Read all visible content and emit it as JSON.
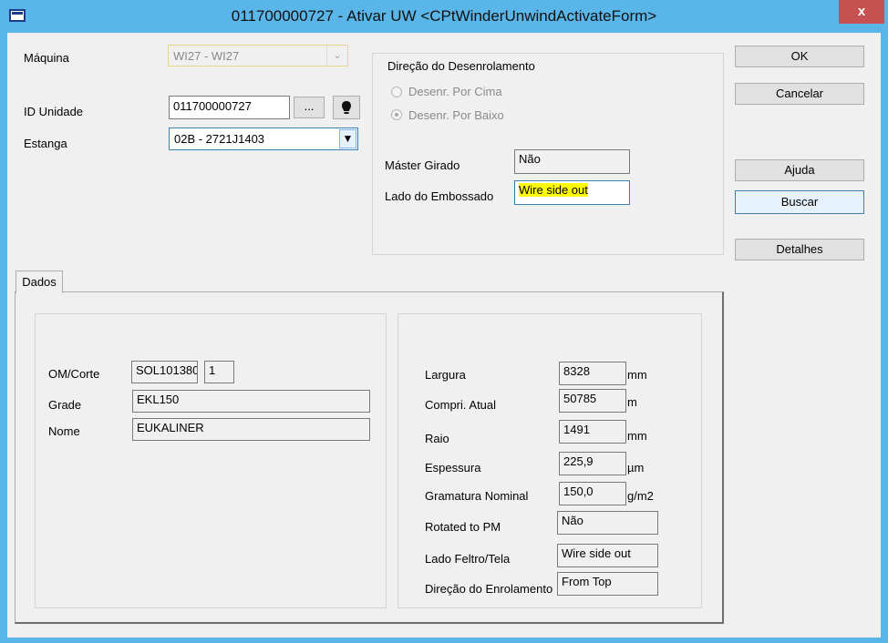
{
  "window": {
    "title": "011700000727 - Ativar UW <CPtWinderUnwindActivateForm>",
    "close_label": "x"
  },
  "header": {
    "maquina": {
      "label": "Máquina",
      "value": "WI27 - WI27"
    },
    "id_unidade": {
      "label": "ID Unidade",
      "value": "011700000727",
      "browse_label": "..."
    },
    "estanga": {
      "label": "Estanga",
      "value": "02B - 2721J1403"
    }
  },
  "direction_group": {
    "title": "Direção do Desenrolamento",
    "options": [
      {
        "label": "Desenr. Por Cima",
        "selected": false
      },
      {
        "label": "Desenr. Por Baixo",
        "selected": true
      }
    ],
    "master_girado": {
      "label": "Máster Girado",
      "value": "Não"
    },
    "lado_embossado": {
      "label": "Lado do Embossado",
      "value": "Wire side out",
      "highlight": "#ffff00"
    }
  },
  "buttons": {
    "ok": "OK",
    "cancelar": "Cancelar",
    "ajuda": "Ajuda",
    "buscar": "Buscar",
    "detalhes": "Detalhes"
  },
  "tabs": [
    {
      "label": "Dados",
      "active": true
    }
  ],
  "dados_left": {
    "om_corte": {
      "label": "OM/Corte",
      "value": "SOL101380",
      "value2": "1"
    },
    "grade": {
      "label": "Grade",
      "value": "EKL150"
    },
    "nome": {
      "label": "Nome",
      "value": "EUKALINER"
    }
  },
  "dados_right": {
    "largura": {
      "label": "Largura",
      "value": "8328",
      "unit": "mm"
    },
    "compri_atual": {
      "label": "Compri. Atual",
      "value": "50785",
      "unit": "m"
    },
    "raio": {
      "label": "Raio",
      "value": "1491",
      "unit": "mm"
    },
    "espessura": {
      "label": "Espessura",
      "value": "225,9",
      "unit": "µm"
    },
    "gramatura": {
      "label": "Gramatura Nominal",
      "value": "150,0",
      "unit": "g/m2"
    },
    "rotated": {
      "label": "Rotated to PM",
      "value": "Não"
    },
    "lado_feltro": {
      "label": "Lado Feltro/Tela",
      "value": "Wire side out"
    },
    "direcao_enrol": {
      "label": "Direção do Enrolamento",
      "value": "From Top"
    }
  }
}
